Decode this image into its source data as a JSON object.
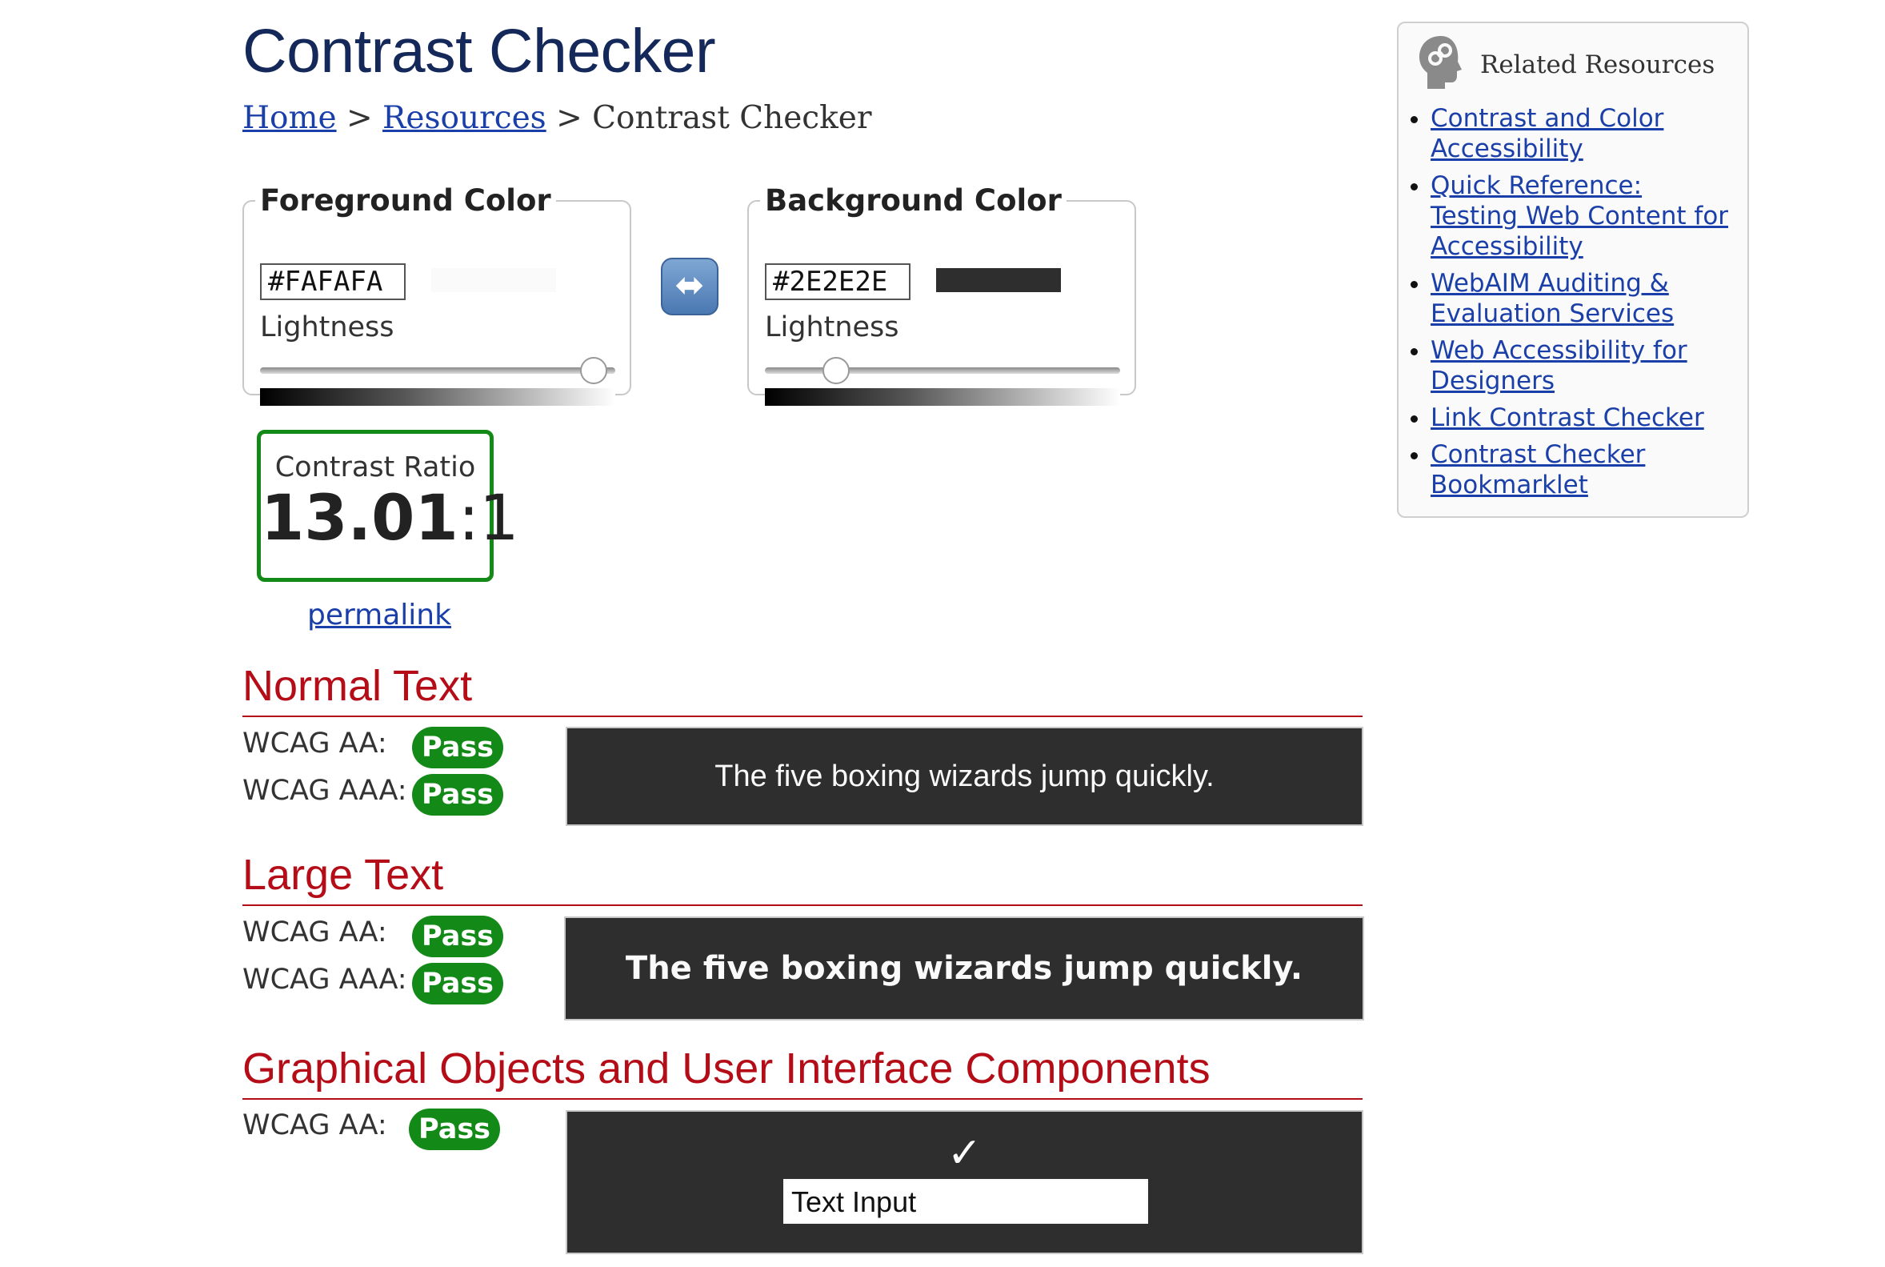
{
  "page": {
    "title": "Contrast Checker"
  },
  "breadcrumb": {
    "home": "Home",
    "sep1": " > ",
    "resources": "Resources",
    "sep2": " > ",
    "current": "Contrast Checker"
  },
  "foreground": {
    "legend": "Foreground Color",
    "hex": "#FAFAFA",
    "lightness_label": "Lightness",
    "swatch_color": "#FAFAFA",
    "lightness_level": 0.94
  },
  "background": {
    "legend": "Background Color",
    "hex": "#2E2E2E",
    "lightness_label": "Lightness",
    "swatch_color": "#2E2E2E",
    "lightness_level": 0.2
  },
  "swap": {
    "icon": "swap-horizontal-icon",
    "glyph": "⬌"
  },
  "contrast": {
    "label": "Contrast Ratio",
    "value": "13.01",
    "suffix": ":1",
    "permalink": "permalink",
    "border_color": "#138a18"
  },
  "sections": {
    "normal": {
      "heading": "Normal Text",
      "aa_label": "WCAG AA:",
      "aa_result": "Pass",
      "aaa_label": "WCAG AAA:",
      "aaa_result": "Pass",
      "sample": "The five boxing wizards jump quickly."
    },
    "large": {
      "heading": "Large Text",
      "aa_label": "WCAG AA:",
      "aa_result": "Pass",
      "aaa_label": "WCAG AAA:",
      "aaa_result": "Pass",
      "sample": "The five boxing wizards jump quickly."
    },
    "graphical": {
      "heading": "Graphical Objects and User Interface Components",
      "aa_label": "WCAG AA:",
      "aa_result": "Pass",
      "check_glyph": "✓",
      "input_value": "Text Input"
    }
  },
  "sidebar": {
    "title": "Related Resources",
    "icon": "link-head-icon",
    "links": [
      "Contrast and Color Accessibility",
      "Quick Reference: Testing Web Content for Accessibility",
      "WebAIM Auditing & Evaluation Services",
      "Web Accessibility for Designers",
      "Link Contrast Checker",
      "Contrast Checker Bookmarklet"
    ]
  },
  "colors": {
    "heading_red": "#b50d18",
    "pass_green": "#138a18",
    "title_navy": "#14285a",
    "link_blue": "#1a3fa8"
  }
}
